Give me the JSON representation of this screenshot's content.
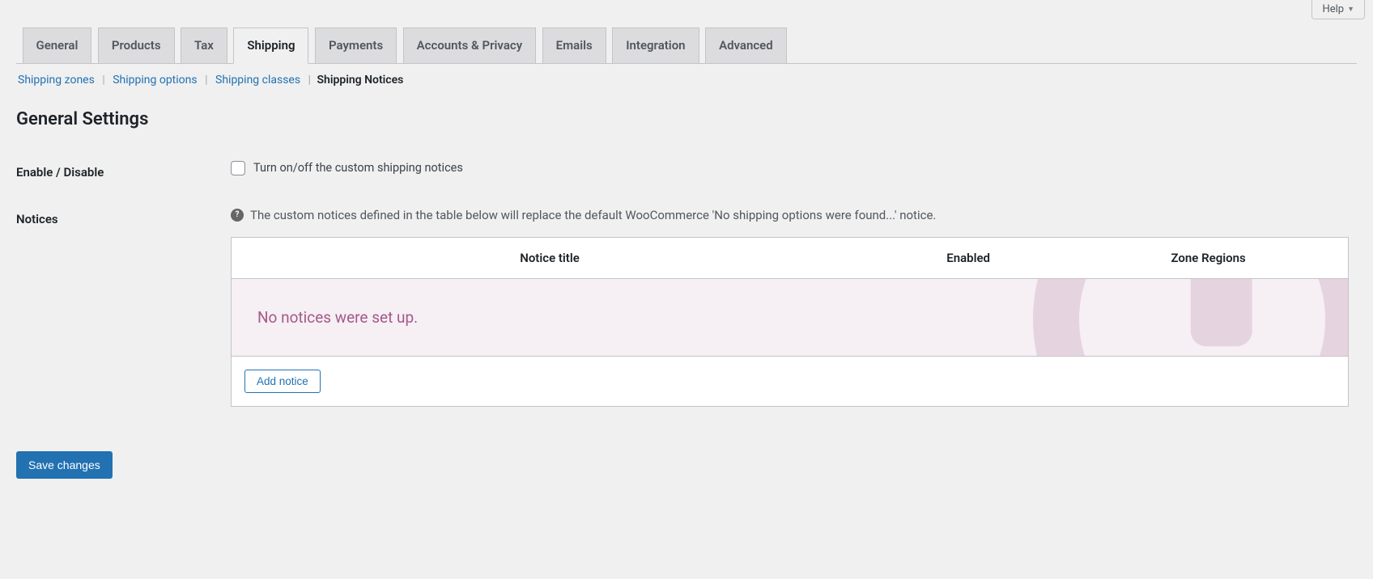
{
  "help_tab": {
    "label": "Help"
  },
  "tabs": [
    {
      "label": "General"
    },
    {
      "label": "Products"
    },
    {
      "label": "Tax"
    },
    {
      "label": "Shipping",
      "active": true
    },
    {
      "label": "Payments"
    },
    {
      "label": "Accounts & Privacy"
    },
    {
      "label": "Emails"
    },
    {
      "label": "Integration"
    },
    {
      "label": "Advanced"
    }
  ],
  "subtabs": [
    {
      "label": "Shipping zones"
    },
    {
      "label": "Shipping options"
    },
    {
      "label": "Shipping classes"
    },
    {
      "label": "Shipping Notices",
      "active": true
    }
  ],
  "section_title": "General Settings",
  "rows": {
    "enable": {
      "label": "Enable / Disable",
      "checkbox_label": "Turn on/off the custom shipping notices"
    },
    "notices": {
      "label": "Notices",
      "description": "The custom notices defined in the table below will replace the default WooCommerce 'No shipping options were found...' notice."
    }
  },
  "table": {
    "col_title": "Notice title",
    "col_enabled": "Enabled",
    "col_zone": "Zone Regions",
    "empty_message": "No notices were set up.",
    "add_button": "Add notice"
  },
  "save_button": "Save changes"
}
